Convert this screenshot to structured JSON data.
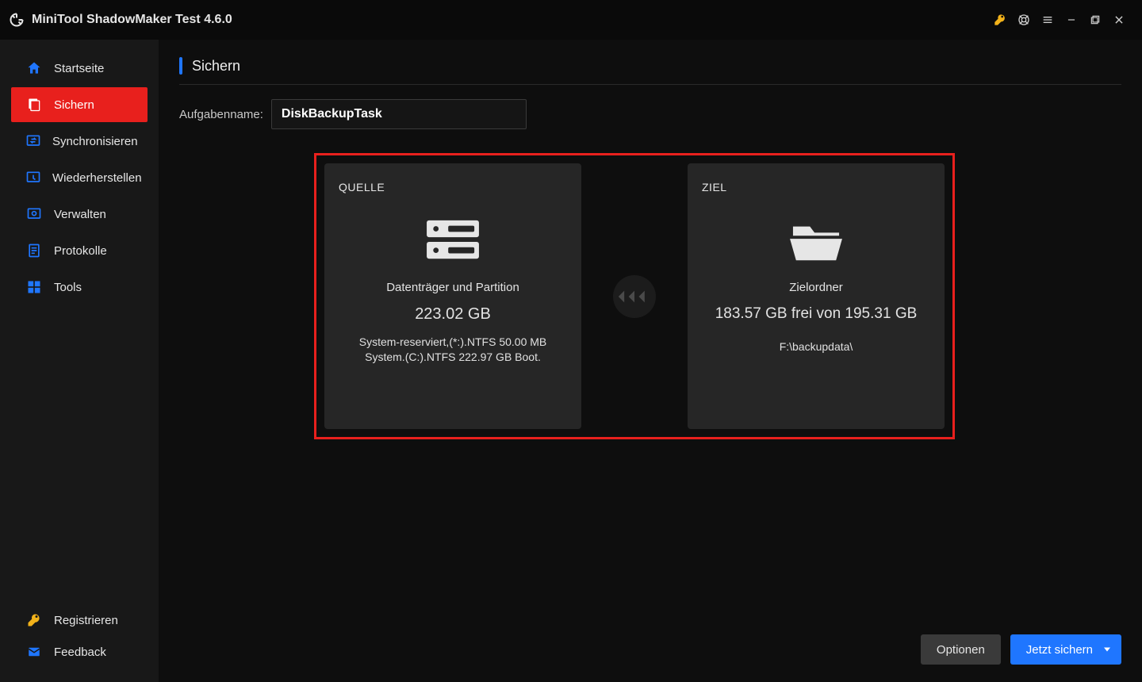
{
  "app": {
    "title": "MiniTool ShadowMaker Test 4.6.0"
  },
  "sidebar": {
    "items": [
      {
        "label": "Startseite"
      },
      {
        "label": "Sichern"
      },
      {
        "label": "Synchronisieren"
      },
      {
        "label": "Wiederherstellen"
      },
      {
        "label": "Verwalten"
      },
      {
        "label": "Protokolle"
      },
      {
        "label": "Tools"
      }
    ],
    "bottom": [
      {
        "label": "Registrieren"
      },
      {
        "label": "Feedback"
      }
    ]
  },
  "page": {
    "title": "Sichern",
    "task_label": "Aufgabenname:",
    "task_value": "DiskBackupTask"
  },
  "source": {
    "heading": "QUELLE",
    "type": "Datenträger und Partition",
    "size": "223.02 GB",
    "detail": "System-reserviert,(*:).NTFS 50.00 MB System.(C:).NTFS 222.97 GB Boot."
  },
  "target": {
    "heading": "ZIEL",
    "type": "Zielordner",
    "size": "183.57 GB frei von 195.31 GB",
    "path": "F:\\backupdata\\"
  },
  "footer": {
    "options": "Optionen",
    "backup_now": "Jetzt sichern"
  }
}
